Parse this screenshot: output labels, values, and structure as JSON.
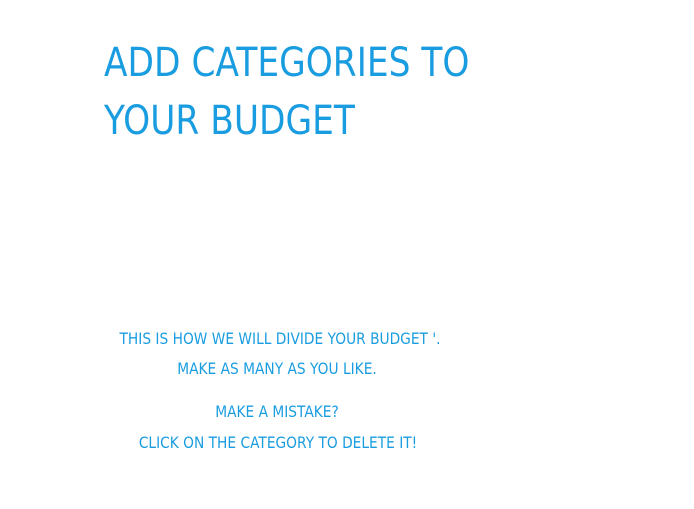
{
  "header": {
    "title_line1": "ADD CATEGORIES TO",
    "title_line2": "YOUR BUDGET"
  },
  "instructions": {
    "line1": "THIS IS HOW WE WILL DIVIDE YOUR BUDGET '.",
    "line2": "MAKE AS  MANY AS YOU LIKE.",
    "line3": "MAKE A MISTAKE?",
    "line4": "CLICK ON THE CATEGORY TO DELETE IT!"
  },
  "colors": {
    "accent": "#1a9de0",
    "background": "#ffffff"
  }
}
